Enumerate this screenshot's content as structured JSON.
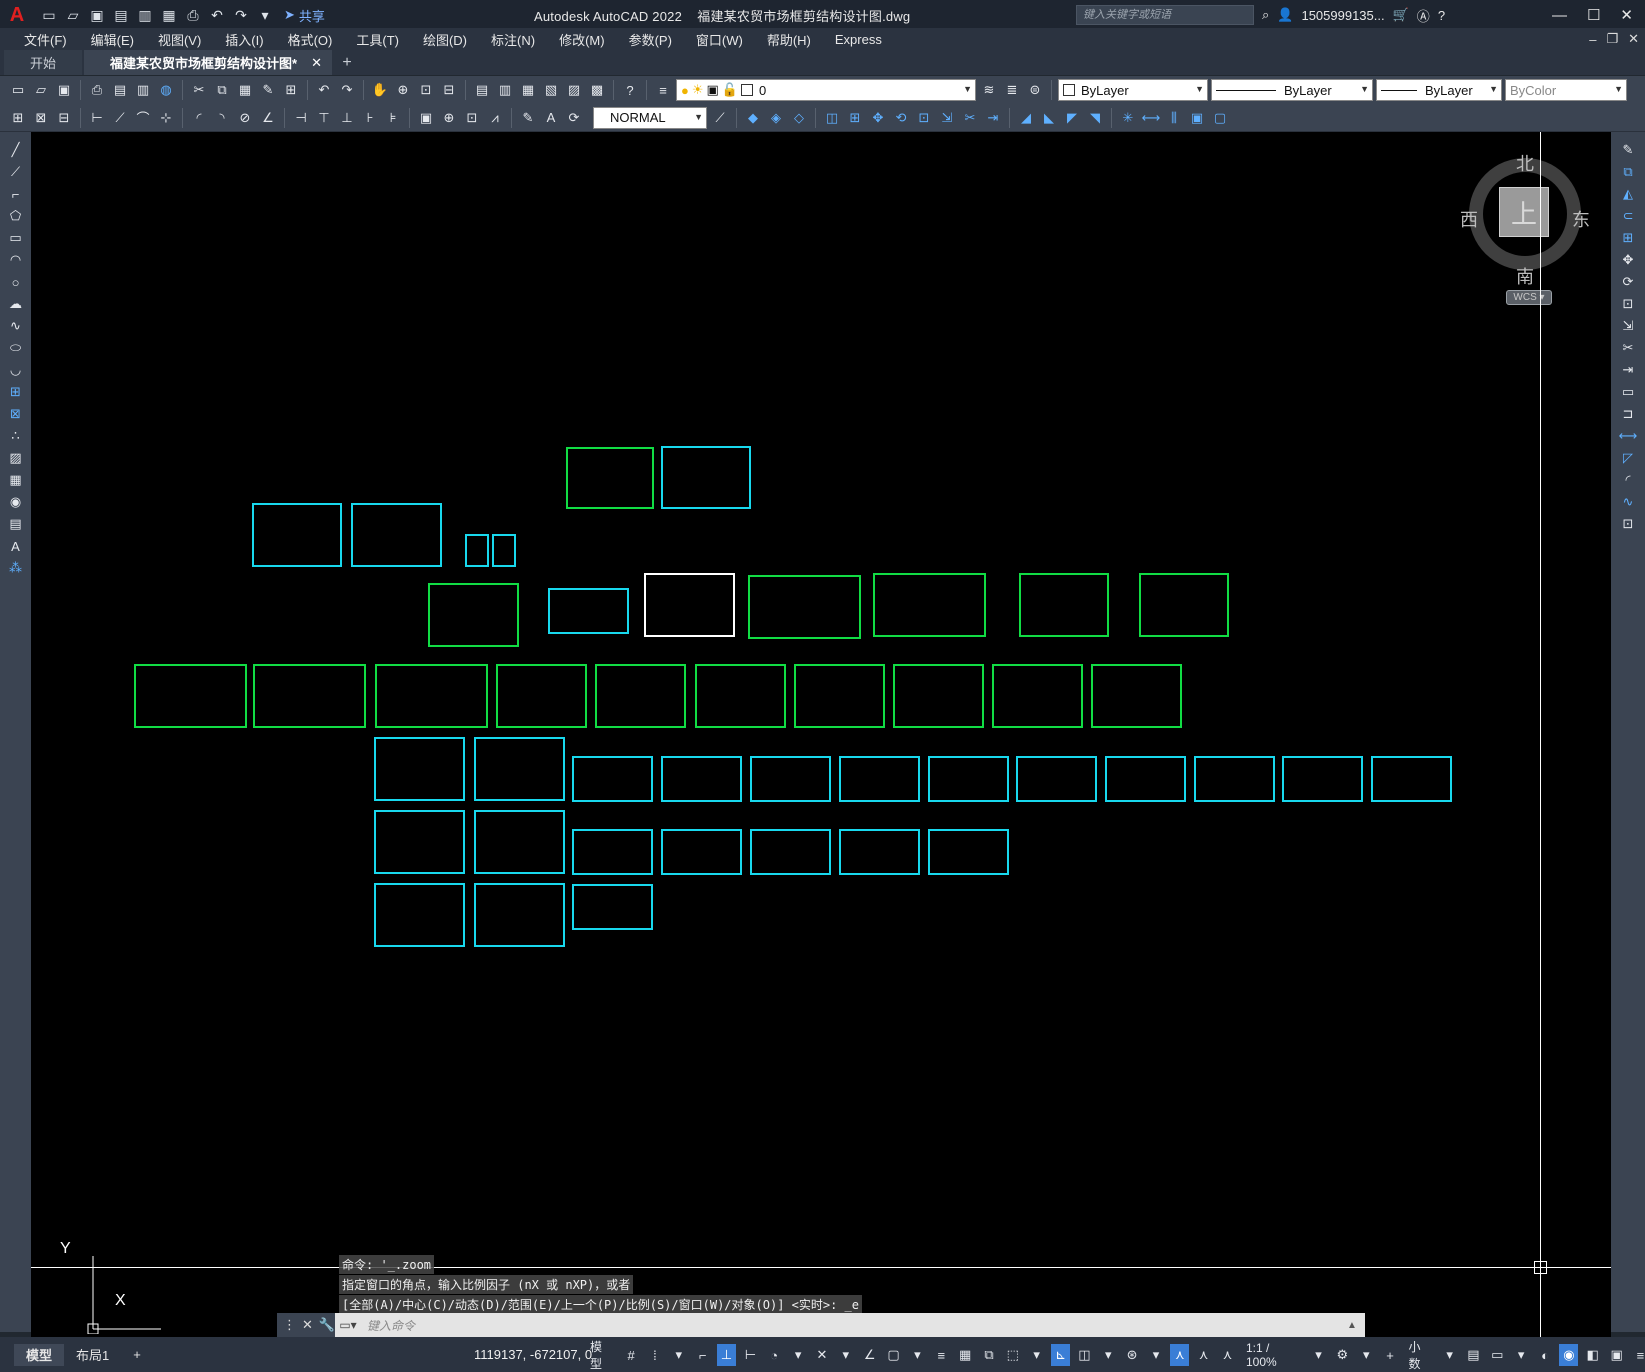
{
  "app": {
    "title": "Autodesk AutoCAD 2022",
    "filename": "福建某农贸市场框剪结构设计图.dwg",
    "logo": "A",
    "share_label": "共享",
    "search_placeholder": "键入关键字或短语",
    "user": "1505999135...",
    "accent": "#3a7ed6"
  },
  "menu": [
    "文件(F)",
    "编辑(E)",
    "视图(V)",
    "插入(I)",
    "格式(O)",
    "工具(T)",
    "绘图(D)",
    "标注(N)",
    "修改(M)",
    "参数(P)",
    "窗口(W)",
    "帮助(H)",
    "Express"
  ],
  "tabs": {
    "start": "开始",
    "document": "福建某农贸市场框剪结构设计图*",
    "add": "+"
  },
  "properties": {
    "layer": "0",
    "color": "ByLayer",
    "linetype": "ByLayer",
    "lineweight": "ByLayer",
    "plotstyle": "ByColor",
    "dimstyle": "NORMAL"
  },
  "viewcube": {
    "north": "北",
    "south": "南",
    "west": "西",
    "east": "东",
    "top": "上",
    "wcs": "WCS"
  },
  "ucs": {
    "y": "Y",
    "x": "X"
  },
  "command": {
    "history": [
      "命令: '_.zoom",
      "指定窗口的角点，输入比例因子 (nX 或 nXP)，或者",
      "[全部(A)/中心(C)/动态(D)/范围(E)/上一个(P)/比例(S)/窗口(W)/对象(O)] <实时>: _e"
    ],
    "placeholder": "键入命令"
  },
  "status": {
    "model_tab": "模型",
    "layout_tab": "布局1",
    "add": "+",
    "coords": "1119137, -672107, 0",
    "model": "模型",
    "scale": "1:1 / 100%",
    "units": "小数"
  }
}
